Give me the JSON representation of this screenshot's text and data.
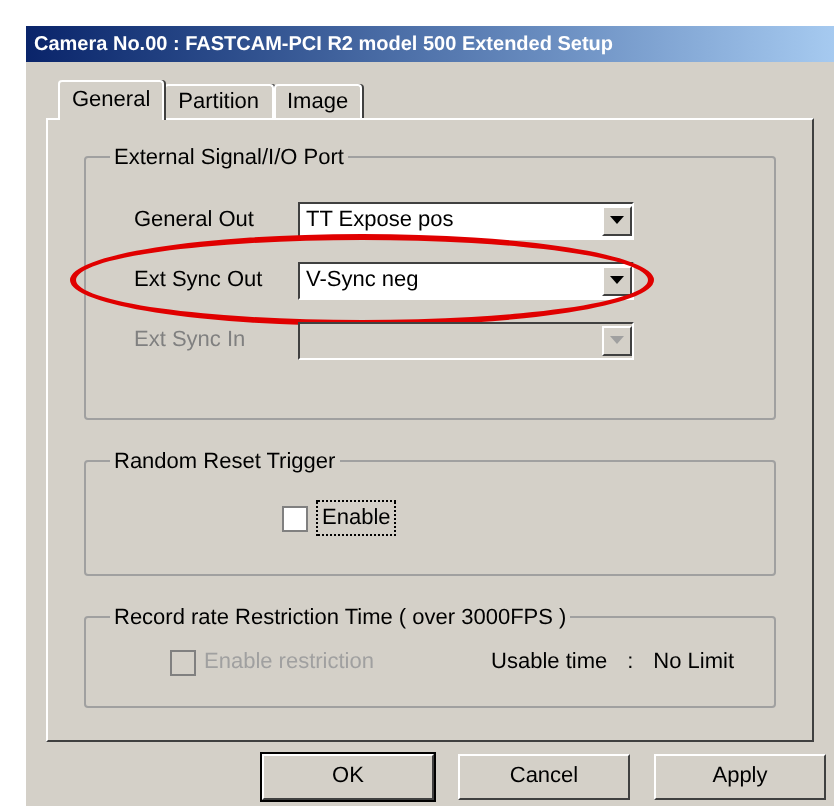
{
  "window": {
    "title": "Camera No.00 : FASTCAM-PCI R2 model 500 Extended Setup"
  },
  "tabs": [
    {
      "label": "General",
      "selected": true
    },
    {
      "label": "Partition",
      "selected": false
    },
    {
      "label": "Image",
      "selected": false
    }
  ],
  "external_signal": {
    "title": "External Signal/I/O Port",
    "fields": [
      {
        "label": "General Out",
        "value": "TT Expose pos",
        "disabled": false,
        "highlighted": false
      },
      {
        "label": "Ext Sync Out",
        "value": "V-Sync neg",
        "disabled": false,
        "highlighted": true
      },
      {
        "label": "Ext Sync In",
        "disabled": true,
        "highlighted": false
      }
    ]
  },
  "random_reset": {
    "title": "Random Reset Trigger",
    "checkbox": {
      "label": "Enable",
      "checked": false,
      "disabled": false
    }
  },
  "record_rate": {
    "title": "Record rate Restriction Time ( over 3000FPS )",
    "checkbox": {
      "label": "Enable restriction",
      "checked": false,
      "disabled": true
    },
    "usable_time_label": "Usable time",
    "separator": ":",
    "usable_time_value": "No Limit"
  },
  "buttons": [
    {
      "label": "OK",
      "default": true
    },
    {
      "label": "Cancel",
      "default": false
    },
    {
      "label": "Apply",
      "default": false
    }
  ]
}
